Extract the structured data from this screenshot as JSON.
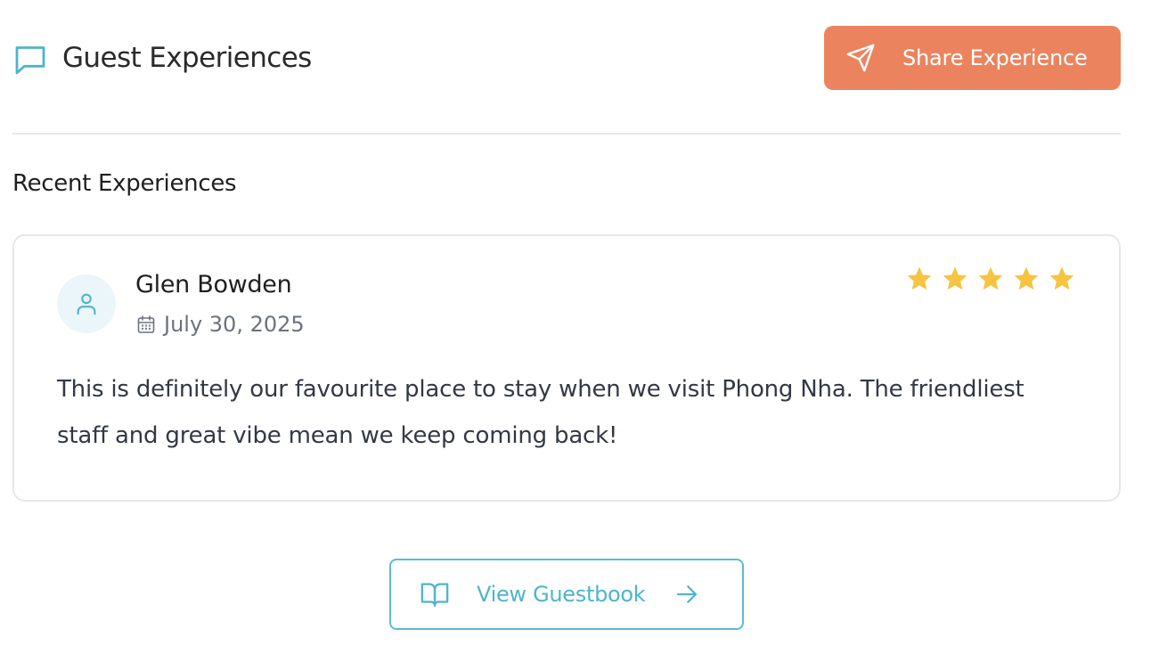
{
  "header": {
    "title": "Guest Experiences",
    "icon": "message-square-icon",
    "share_button": {
      "label": "Share Experience",
      "icon": "send-icon",
      "color": "#eb845e"
    }
  },
  "section": {
    "title": "Recent Experiences"
  },
  "reviews": [
    {
      "author": "Glen Bowden",
      "date": "July 30, 2025",
      "rating": 5,
      "max_rating": 5,
      "text": "This is definitely our favourite place to stay when we visit Phong Nha. The friendliest staff and great vibe mean we keep coming back!"
    }
  ],
  "footer": {
    "guestbook_button": {
      "label": "View Guestbook",
      "icon": "book-open-icon",
      "trailing_icon": "arrow-right-icon"
    }
  },
  "colors": {
    "accent": "#4fb4cc",
    "star": "#f5c542",
    "primary_button": "#eb845e"
  }
}
